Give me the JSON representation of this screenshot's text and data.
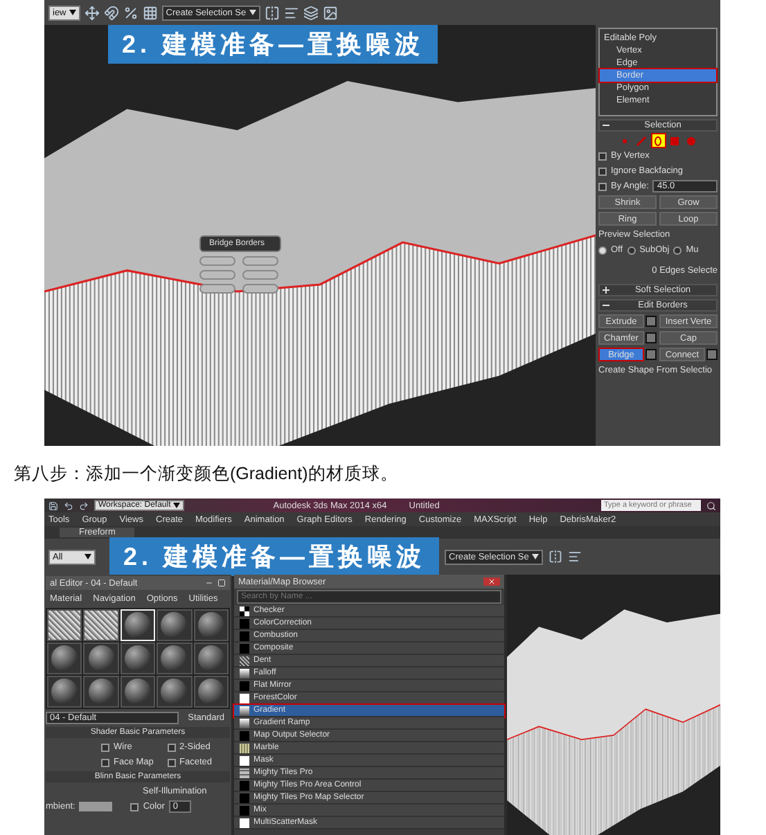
{
  "screenshot_top": {
    "view_dropdown": "iew",
    "selection_set": "Create Selection Se",
    "banner": "2. 建模准备—置换噪波",
    "caddy": {
      "title": "Bridge Borders"
    },
    "modifier_stack": [
      {
        "label": "Editable Poly",
        "kind": "root",
        "selected": false
      },
      {
        "label": "Vertex",
        "kind": "sub",
        "selected": false
      },
      {
        "label": "Edge",
        "kind": "sub",
        "selected": false
      },
      {
        "label": "Border",
        "kind": "sub",
        "selected": true
      },
      {
        "label": "Polygon",
        "kind": "sub",
        "selected": false
      },
      {
        "label": "Element",
        "kind": "sub",
        "selected": false
      }
    ],
    "selection": {
      "title": "Selection",
      "expanded": true,
      "modes": [
        {
          "kind": "vertex",
          "selected": false
        },
        {
          "kind": "edge",
          "selected": false
        },
        {
          "kind": "border",
          "selected": true
        },
        {
          "kind": "polygon",
          "selected": false
        },
        {
          "kind": "element",
          "selected": false
        }
      ],
      "options": [
        {
          "label": "By Vertex",
          "checked": false
        },
        {
          "label": "Ignore Backfacing",
          "checked": false
        },
        {
          "label": "By Angle:",
          "checked": false,
          "value": "45.0"
        }
      ],
      "buttons": [
        "Shrink",
        "Grow",
        "Ring",
        "Loop"
      ],
      "preview_title": "Preview Selection",
      "preview_options": [
        {
          "label": "Off",
          "selected": true
        },
        {
          "label": "SubObj",
          "selected": false
        },
        {
          "label": "Mu",
          "selected": false
        }
      ],
      "status": "0 Edges Selecte"
    },
    "rollouts": [
      {
        "title": "Soft Selection",
        "expanded": false
      },
      {
        "title": "Edit Borders",
        "expanded": true
      }
    ],
    "edit_buttons": [
      {
        "label": "Extrude",
        "settings": true,
        "selected": false
      },
      {
        "label": "Insert Verte",
        "settings": false,
        "selected": false
      },
      {
        "label": "Chamfer",
        "settings": true,
        "selected": false
      },
      {
        "label": "Cap",
        "settings": false,
        "selected": false
      },
      {
        "label": "Bridge",
        "settings": true,
        "selected": true
      },
      {
        "label": "Connect",
        "settings": true,
        "selected": false
      }
    ],
    "footer": "Create Shape From Selectio"
  },
  "caption": "第八步：添加一个渐变颜色(Gradient)的材质球。",
  "screenshot_bottom": {
    "workspace": "Workspace: Default",
    "app_title": "Autodesk 3ds Max 2014 x64",
    "document": "Untitled",
    "search_placeholder": "Type a keyword or phrase",
    "menu": [
      "Tools",
      "Group",
      "Views",
      "Create",
      "Modifiers",
      "Animation",
      "Graph Editors",
      "Rendering",
      "Customize",
      "MAXScript",
      "Help",
      "DebrisMaker2"
    ],
    "ribbon_tab": "Freeform",
    "filter": "All",
    "banner": "2. 建模准备—置换噪波",
    "selection_set": "Create Selection Se",
    "material_editor": {
      "title": "al Editor - 04 - Default",
      "menu": [
        "Material",
        "Navigation",
        "Options",
        "Utilities"
      ],
      "slots": [
        {
          "kind": "noise",
          "selected": false
        },
        {
          "kind": "noise",
          "selected": false
        },
        {
          "kind": "sphere",
          "selected": true
        },
        {
          "kind": "sphere",
          "selected": false
        },
        {
          "kind": "sphere",
          "selected": false
        },
        {
          "kind": "sphere",
          "selected": false
        },
        {
          "kind": "sphere",
          "selected": false
        },
        {
          "kind": "sphere",
          "selected": false
        },
        {
          "kind": "sphere",
          "selected": false
        },
        {
          "kind": "sphere",
          "selected": false
        },
        {
          "kind": "sphere",
          "selected": false
        },
        {
          "kind": "sphere",
          "selected": false
        },
        {
          "kind": "sphere",
          "selected": false
        },
        {
          "kind": "sphere",
          "selected": false
        },
        {
          "kind": "sphere",
          "selected": false
        }
      ],
      "material_name": "04 - Default",
      "material_type": "Standard",
      "shader_title": "Shader Basic Parameters",
      "shader_options": [
        {
          "label": "Wire",
          "checked": false
        },
        {
          "label": "2-Sided",
          "checked": false
        },
        {
          "label": "Face Map",
          "checked": false
        },
        {
          "label": "Faceted",
          "checked": false
        }
      ],
      "blinn_title": "Blinn Basic Parameters",
      "self_illum_title": "Self-Illumination",
      "ambient_label": "mbient:",
      "color_label": "Color",
      "color_checked": false,
      "color_value": "0"
    },
    "browser": {
      "title": "Material/Map Browser",
      "search_placeholder": "Search by Name ...",
      "items": [
        {
          "label": "Checker",
          "kind": "checker",
          "selected": false
        },
        {
          "label": "ColorCorrection",
          "kind": "black",
          "selected": false
        },
        {
          "label": "Combustion",
          "kind": "black",
          "selected": false
        },
        {
          "label": "Composite",
          "kind": "black",
          "selected": false
        },
        {
          "label": "Dent",
          "kind": "dent",
          "selected": false
        },
        {
          "label": "Falloff",
          "kind": "gradient",
          "selected": false
        },
        {
          "label": "Flat Mirror",
          "kind": "black",
          "selected": false
        },
        {
          "label": "ForestColor",
          "kind": "white",
          "selected": false
        },
        {
          "label": "Gradient",
          "kind": "gradient",
          "selected": true
        },
        {
          "label": "Gradient Ramp",
          "kind": "gradient",
          "selected": false
        },
        {
          "label": "Map Output Selector",
          "kind": "black",
          "selected": false
        },
        {
          "label": "Marble",
          "kind": "marble",
          "selected": false
        },
        {
          "label": "Mask",
          "kind": "white",
          "selected": false
        },
        {
          "label": "Mighty Tiles Pro",
          "kind": "tiles",
          "selected": false
        },
        {
          "label": "Mighty Tiles Pro Area Control",
          "kind": "black",
          "selected": false
        },
        {
          "label": "Mighty Tiles Pro Map Selector",
          "kind": "black",
          "selected": false
        },
        {
          "label": "Mix",
          "kind": "black",
          "selected": false
        },
        {
          "label": "MultiScatterMask",
          "kind": "white",
          "selected": false
        }
      ]
    }
  }
}
